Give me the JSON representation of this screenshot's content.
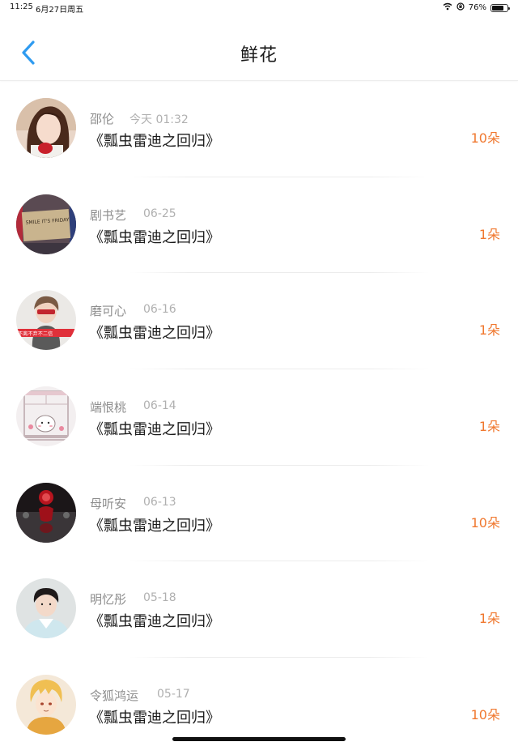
{
  "status_bar": {
    "time": "11:25",
    "date": "6月27日周五",
    "battery": "76%",
    "battery_level": 0.76
  },
  "header": {
    "title": "鲜花"
  },
  "colors": {
    "accent_blue": "#2f9bf0",
    "count_orange": "#f0782f"
  },
  "items": [
    {
      "name": "邵伦",
      "date": "今天 01:32",
      "book": "《瓢虫雷迪之回归》",
      "count": "10朵",
      "avatar": "girl-portrait"
    },
    {
      "name": "剧书艺",
      "date": "06-25",
      "book": "《瓢虫雷迪之回归》",
      "count": "1朵",
      "avatar": "smile-sign",
      "avatar_text": "SMILE IT'S FRIDAY"
    },
    {
      "name": "磨可心",
      "date": "06-16",
      "book": "《瓢虫雷迪之回归》",
      "count": "1朵",
      "avatar": "boy-red-banner",
      "avatar_text": "不离不弃不二信"
    },
    {
      "name": "端恨桃",
      "date": "06-14",
      "book": "《瓢虫雷迪之回归》",
      "count": "1朵",
      "avatar": "cartoon-window"
    },
    {
      "name": "母听安",
      "date": "06-13",
      "book": "《瓢虫雷迪之回归》",
      "count": "10朵",
      "avatar": "red-figure-dark"
    },
    {
      "name": "明忆彤",
      "date": "05-18",
      "book": "《瓢虫雷迪之回归》",
      "count": "1朵",
      "avatar": "boy-portrait"
    },
    {
      "name": "令狐鸿运",
      "date": "05-17",
      "book": "《瓢虫雷迪之回归》",
      "count": "10朵",
      "avatar": "anime-blonde"
    }
  ]
}
